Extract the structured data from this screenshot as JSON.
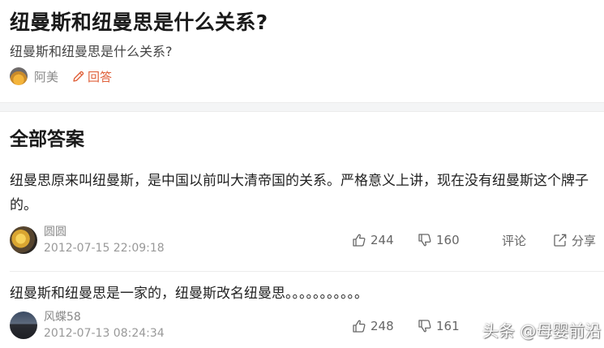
{
  "question": {
    "title": "纽曼斯和纽曼思是什么关系?",
    "description": "纽曼斯和纽曼思是什么关系?",
    "author": "阿美",
    "answer_label": "回答"
  },
  "section_title": "全部答案",
  "answers": [
    {
      "text": "纽曼思原来叫纽曼斯，是中国以前叫大清帝国的关系。严格意义上讲，现在没有纽曼斯这个牌子的。",
      "user": "圆圆",
      "date": "2012-07-15 22:09:18",
      "likes": "244",
      "dislikes": "160",
      "comment_label": "评论",
      "share_label": "分享"
    },
    {
      "text": "纽曼斯和纽曼思是一家的，纽曼斯改名纽曼思。。。。。。。。。。。",
      "user": "风蝶58",
      "date": "2012-07-13 08:24:34",
      "likes": "248",
      "dislikes": "161"
    }
  ],
  "watermark": "头条 @母婴前沿",
  "colors": {
    "accent": "#e0623c",
    "meta": "#888888",
    "background": "#ffffff"
  },
  "icons": [
    "pencil-icon",
    "thumbs-up-icon",
    "thumbs-down-icon",
    "share-icon"
  ]
}
